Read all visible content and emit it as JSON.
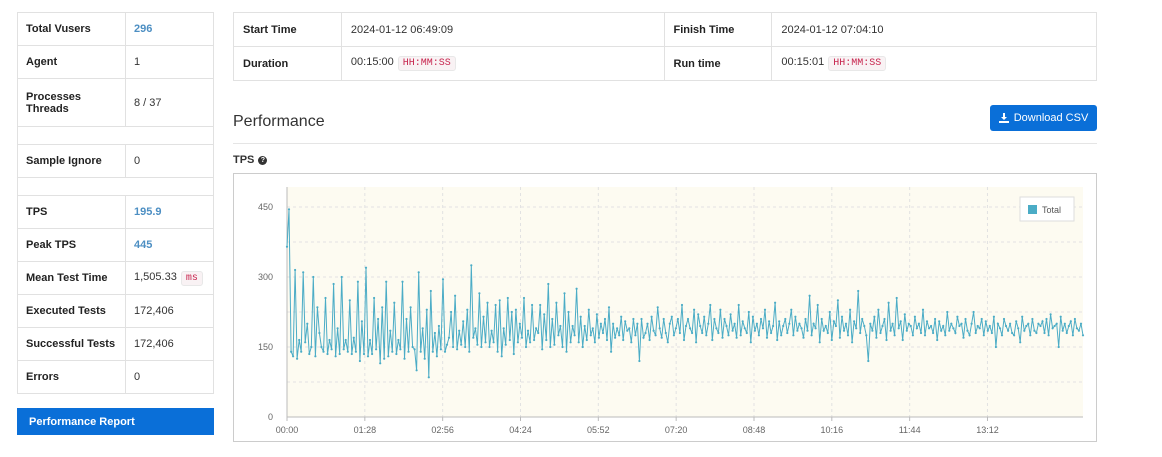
{
  "stats": {
    "total_vusers": {
      "label": "Total Vusers",
      "value": "296"
    },
    "agent": {
      "label": "Agent",
      "value": "1"
    },
    "processes_threads": {
      "label_line1": "Processes",
      "label_line2": "Threads",
      "value": "8 / 37"
    },
    "sample_ignore": {
      "label": "Sample Ignore",
      "value": "0"
    },
    "tps": {
      "label": "TPS",
      "value": "195.9"
    },
    "peak_tps": {
      "label": "Peak TPS",
      "value": "445"
    },
    "mean_test_time": {
      "label": "Mean Test Time",
      "value": "1,505.33",
      "unit": "ms"
    },
    "executed_tests": {
      "label": "Executed Tests",
      "value": "172,406"
    },
    "successful_tests": {
      "label": "Successful Tests",
      "value": "172,406"
    },
    "errors": {
      "label": "Errors",
      "value": "0"
    }
  },
  "performance_report_button": "Performance Report",
  "summary": {
    "start_time": {
      "label": "Start Time",
      "value": "2024-01-12 06:49:09"
    },
    "finish_time": {
      "label": "Finish Time",
      "value": "2024-01-12 07:04:10"
    },
    "duration": {
      "label": "Duration",
      "value": "00:15:00",
      "format": "HH:MM:SS"
    },
    "run_time": {
      "label": "Run time",
      "value": "00:15:01",
      "format": "HH:MM:SS"
    }
  },
  "performance_title": "Performance",
  "download_csv_label": "Download CSV",
  "tps_chart_label": "TPS",
  "colors": {
    "accent": "#0a6fd8",
    "series": "#4bacc6",
    "plot_bg": "#fdfbf1"
  },
  "chart_data": {
    "type": "line",
    "title": "",
    "xlabel": "",
    "ylabel": "",
    "ylim": [
      0,
      450
    ],
    "yticks": [
      "0",
      "150",
      "300",
      "450"
    ],
    "xticks": [
      "00:00",
      "01:28",
      "02:56",
      "04:24",
      "05:52",
      "07:20",
      "08:48",
      "10:16",
      "11:44",
      "13:12"
    ],
    "legend_position": "top-right",
    "grid": true,
    "series": [
      {
        "name": "Total",
        "values": [
          365,
          445,
          140,
          130,
          315,
          125,
          165,
          140,
          310,
          160,
          200,
          135,
          150,
          300,
          130,
          235,
          180,
          150,
          140,
          255,
          135,
          165,
          145,
          285,
          130,
          190,
          135,
          300,
          145,
          165,
          140,
          250,
          135,
          170,
          140,
          290,
          120,
          205,
          135,
          320,
          130,
          165,
          135,
          255,
          145,
          210,
          115,
          235,
          125,
          290,
          130,
          185,
          140,
          245,
          135,
          165,
          145,
          290,
          125,
          210,
          140,
          235,
          150,
          145,
          100,
          310,
          140,
          190,
          125,
          230,
          85,
          270,
          140,
          180,
          130,
          195,
          145,
          295,
          140,
          155,
          170,
          225,
          150,
          260,
          145,
          185,
          155,
          205,
          150,
          230,
          140,
          325,
          170,
          190,
          155,
          265,
          150,
          215,
          160,
          245,
          150,
          185,
          160,
          240,
          140,
          250,
          130,
          190,
          155,
          255,
          165,
          225,
          135,
          230,
          160,
          200,
          170,
          255,
          150,
          185,
          160,
          240,
          165,
          190,
          180,
          240,
          145,
          220,
          165,
          285,
          150,
          210,
          155,
          245,
          175,
          195,
          150,
          265,
          140,
          225,
          160,
          195,
          175,
          275,
          160,
          215,
          150,
          195,
          165,
          230,
          175,
          190,
          160,
          220,
          170,
          200,
          180,
          210,
          165,
          235,
          140,
          200,
          170,
          190,
          175,
          215,
          165,
          205,
          185,
          190,
          160,
          210,
          175,
          200,
          120,
          210,
          170,
          180,
          200,
          165,
          215,
          185,
          175,
          235,
          190,
          170,
          210,
          180,
          160,
          200,
          215,
          175,
          190,
          210,
          180,
          240,
          165,
          195,
          210,
          190,
          180,
          230,
          160,
          220,
          195,
          180,
          215,
          175,
          200,
          240,
          165,
          210,
          190,
          180,
          230,
          170,
          210,
          195,
          175,
          220,
          185,
          200,
          170,
          240,
          175,
          205,
          190,
          180,
          225,
          160,
          215,
          185,
          200,
          175,
          210,
          190,
          230,
          170,
          205,
          180,
          195,
          245,
          165,
          205,
          175,
          195,
          210,
          180,
          200,
          230,
          175,
          215,
          185,
          200,
          190,
          170,
          210,
          185,
          260,
          175,
          200,
          190,
          240,
          160,
          210,
          185,
          195,
          180,
          225,
          165,
          205,
          195,
          250,
          170,
          215,
          185,
          200,
          175,
          230,
          160,
          205,
          190,
          270,
          180,
          210,
          195,
          175,
          120,
          200,
          185,
          215,
          170,
          230,
          180,
          195,
          210,
          165,
          245,
          185,
          200,
          175,
          255,
          190,
          205,
          165,
          220,
          185,
          200,
          195,
          175,
          215,
          190,
          200,
          180,
          230,
          175,
          205,
          190,
          195,
          180,
          210,
          165,
          205,
          185,
          195,
          175,
          225,
          185,
          200,
          190,
          180,
          215,
          195,
          200,
          170,
          210,
          185,
          175,
          200,
          225,
          180,
          195,
          190,
          210,
          175,
          205,
          185,
          195,
          180,
          215,
          150,
          200,
          190,
          175,
          210,
          195,
          185,
          200,
          180,
          175,
          205,
          190,
          160,
          215,
          185,
          195,
          200,
          175,
          210,
          185,
          180,
          200,
          195,
          205,
          180,
          210,
          175,
          220,
          190,
          195,
          200,
          150,
          215,
          185,
          200,
          180,
          195,
          205,
          175,
          210,
          190,
          185,
          200,
          175
        ]
      }
    ]
  }
}
